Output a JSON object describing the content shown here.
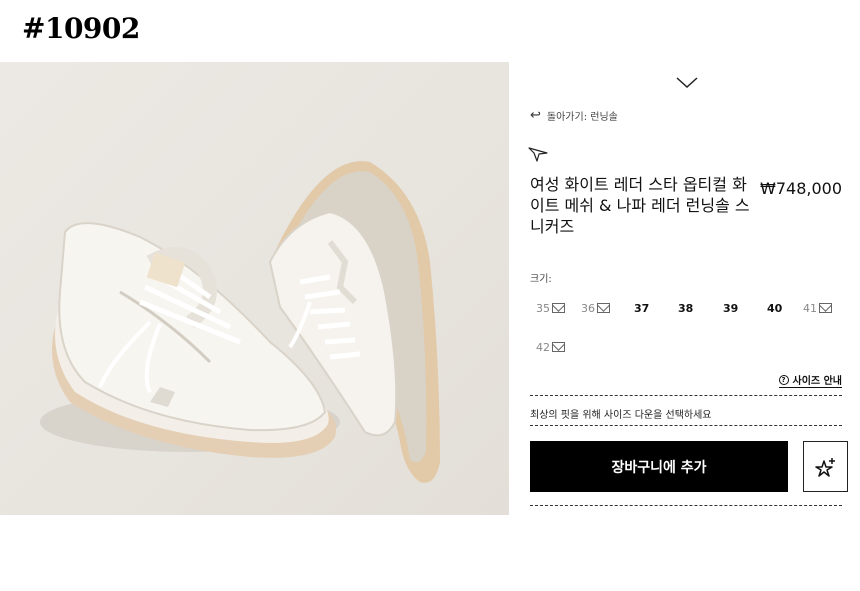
{
  "header": {
    "id_tag": "#10902"
  },
  "product": {
    "back_label": "돌아가기: 런닝솔",
    "title": "여성 화이트 레더 스타 옵티컬 화이트 메쉬 & 나파 레더 런닝솔 스니커즈",
    "price": "₩748,000",
    "size_label": "크기:",
    "sizes": [
      "35",
      "36",
      "37",
      "38",
      "39",
      "40",
      "41",
      "42"
    ],
    "size_guide": "사이즈 안내",
    "fit_note": "최상의 핏을 위해 사이즈 다운을 선택하세요",
    "add_to_cart": "장바구니에 추가"
  },
  "icons": [
    "chevron-down-icon",
    "back-arrow-icon",
    "wishlist-star-icon",
    "mail-icon",
    "question-icon",
    "star-plus-icon"
  ]
}
